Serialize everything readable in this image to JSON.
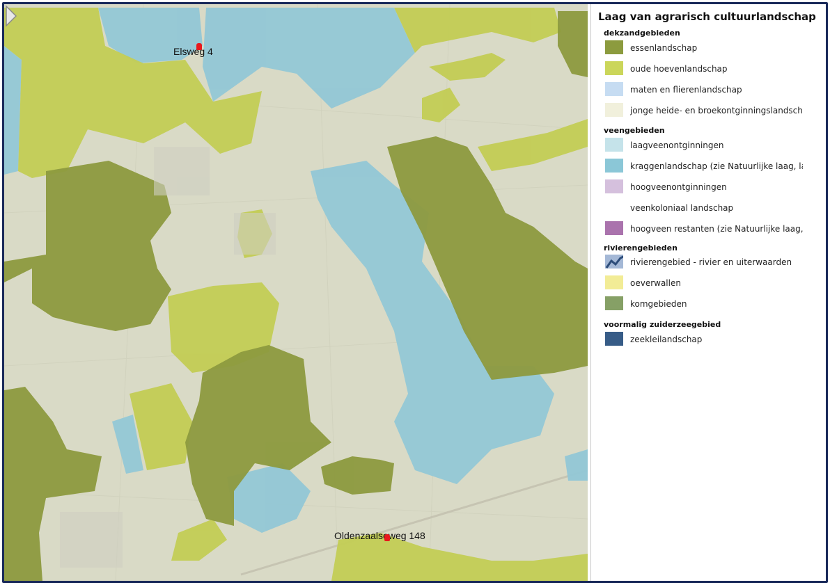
{
  "map": {
    "places": [
      {
        "name": "Elsweg 4"
      },
      {
        "name": "Oldenzaalseweg 148"
      }
    ],
    "colors": {
      "base": "#dcddcb",
      "essen": "#8c9b3e",
      "hoeven": "#c2cd52",
      "kraggen": "#8fc6d4",
      "heide": "#e6e6d6"
    }
  },
  "legend": {
    "title": "Laag van agrarisch cultuurlandschap",
    "groups": [
      {
        "heading": "dekzandgebieden",
        "items": [
          {
            "label": "essenlandschap",
            "color": "#8c9b3e"
          },
          {
            "label": "oude hoevenlandschap",
            "color": "#cbd65a"
          },
          {
            "label": "maten en flierenlandschap",
            "color": "#c6dcf2"
          },
          {
            "label": "jonge heide- en broekontginningslandschap",
            "color": "#f1f0dc"
          }
        ]
      },
      {
        "heading": "veengebieden",
        "items": [
          {
            "label": "laagveenontginningen",
            "color": "#c5e3ea"
          },
          {
            "label": "kraggenlandschap (zie Natuurlijke laag, laag",
            "color": "#8bc7d7"
          },
          {
            "label": "hoogveenontginningen",
            "color": "#d5c0dd"
          },
          {
            "label": "veenkoloniaal landschap",
            "color": "#ffffff"
          },
          {
            "label": "hoogveen restanten (zie Natuurlijke laag, laag",
            "color": "#aa73ad"
          }
        ]
      },
      {
        "heading": "rivierengebieden",
        "items": [
          {
            "label": "rivierengebied - rivier en uiterwaarden",
            "color": "#a4b8d6",
            "icon": "river-line-icon"
          },
          {
            "label": "oeverwallen",
            "color": "#f2ec96"
          },
          {
            "label": "komgebieden",
            "color": "#86a066"
          }
        ]
      },
      {
        "heading": "voormalig zuiderzeegebied",
        "items": [
          {
            "label": "zeekleilandschap",
            "color": "#375c87"
          }
        ]
      }
    ]
  }
}
